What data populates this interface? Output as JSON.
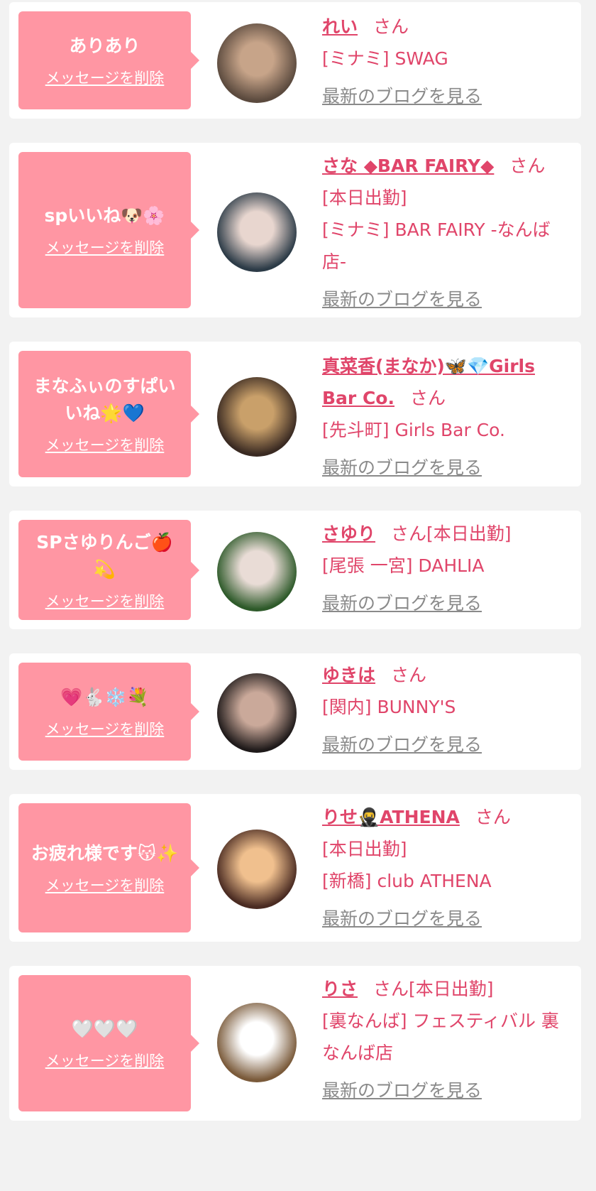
{
  "labels": {
    "delete": "メッセージを削除",
    "blog": "最新のブログを見る",
    "honorific": "さん"
  },
  "items": [
    {
      "message": "ありあり",
      "name": "れい",
      "status": "",
      "shop": "[ミナミ] SWAG",
      "avatar_colors": [
        "#5b4a3e",
        "#c7a489"
      ]
    },
    {
      "message": "spいいね🐶🌸",
      "name": "さな ◆BAR FAIRY◆",
      "status": "[本日出勤]",
      "shop": "[ミナミ] BAR FAIRY -なんば店-",
      "avatar_colors": [
        "#2c3b47",
        "#e8d6cf"
      ]
    },
    {
      "message": "まなふぃのすぱいいね🌟💙",
      "name": "真菜香(まなか)🦋💎Girls Bar Co.",
      "status": "",
      "shop": "[先斗町] Girls Bar Co.",
      "avatar_colors": [
        "#3a2a22",
        "#c9a06a"
      ]
    },
    {
      "message": "SPさゆりんご🍎💫",
      "name": "さゆり",
      "status": "[本日出勤]",
      "shop": "[尾張 一宮] DAHLIA",
      "avatar_colors": [
        "#2e5a2a",
        "#e9dcd6"
      ]
    },
    {
      "message": "💗🐇❄️💐",
      "name": "ゆきは",
      "status": "",
      "shop": "[関内] BUNNY'S",
      "avatar_colors": [
        "#1f1a1a",
        "#caa99a"
      ]
    },
    {
      "message": "お疲れ様です😽✨",
      "name": "りせ🥷ATHENA",
      "status": "[本日出勤]",
      "shop": "[新橋] club ATHENA",
      "avatar_colors": [
        "#4a2b22",
        "#f0c08e"
      ]
    },
    {
      "message": "🤍🤍🤍",
      "name": "りさ",
      "status": "[本日出勤]",
      "shop": "[裏なんば] フェスティバル 裏なんば店",
      "avatar_colors": [
        "#7a5a3a",
        "#ffffff"
      ]
    }
  ]
}
